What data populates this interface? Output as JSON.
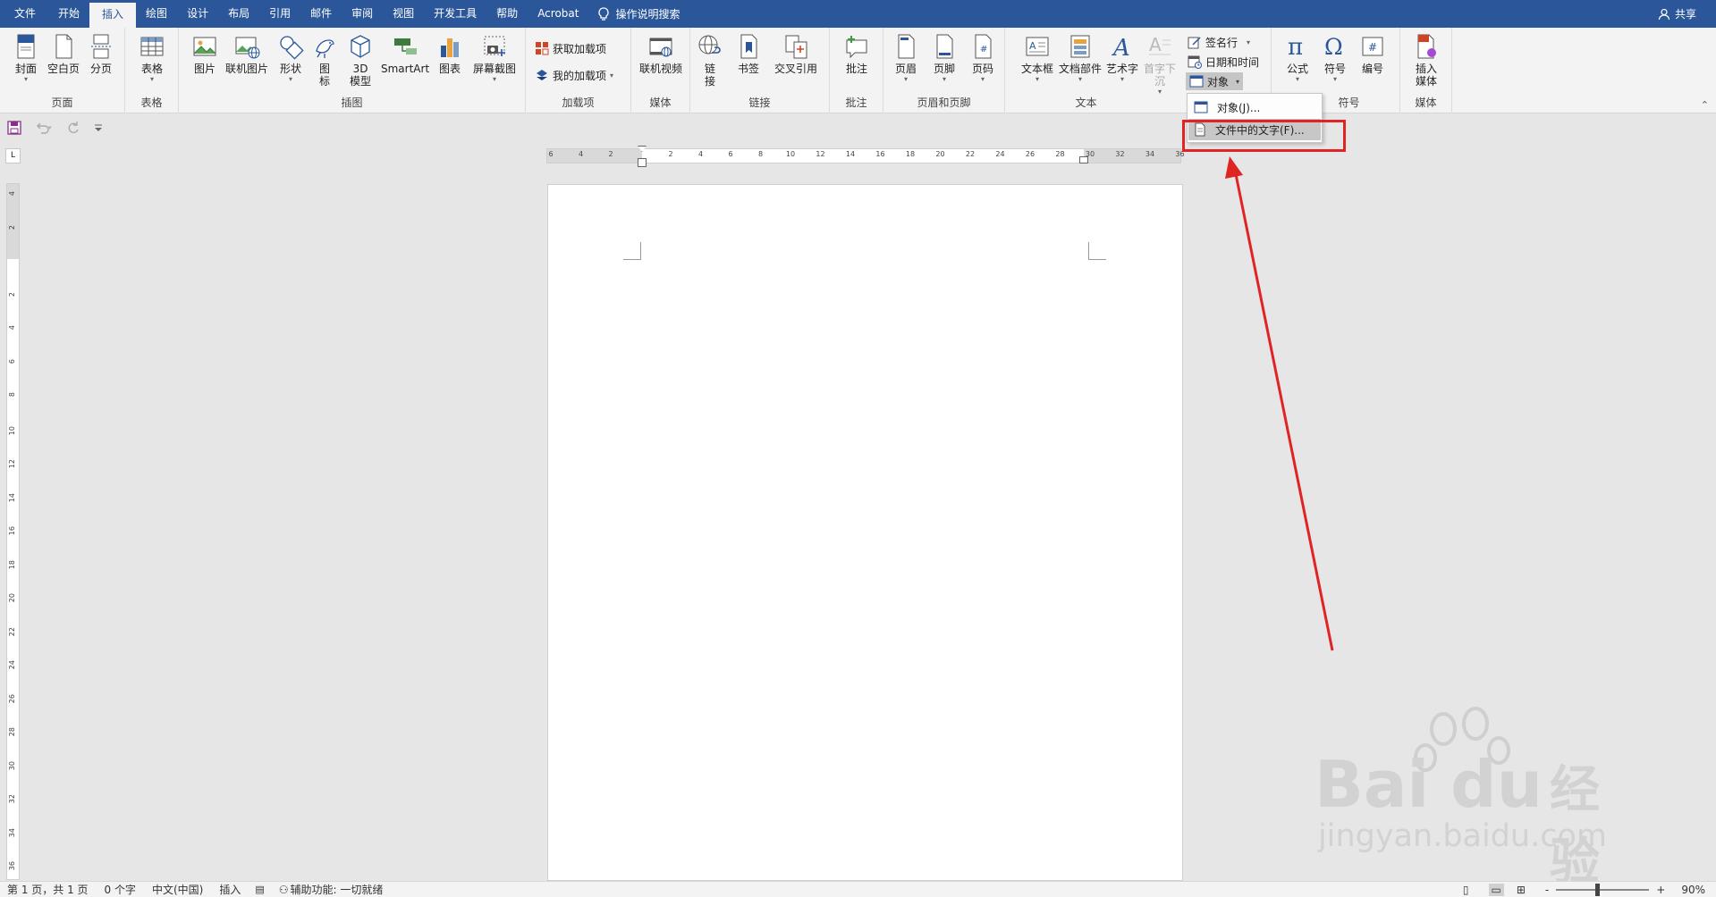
{
  "tabs": [
    "文件",
    "开始",
    "插入",
    "绘图",
    "设计",
    "布局",
    "引用",
    "邮件",
    "审阅",
    "视图",
    "开发工具",
    "帮助",
    "Acrobat"
  ],
  "search_label": "操作说明搜索",
  "share_label": "共享",
  "ribbon": {
    "cover": "封面",
    "blank_page": "空白页",
    "page_break": "分页",
    "group_pages": "页面",
    "table": "表格",
    "group_table": "表格",
    "picture": "图片",
    "online_picture": "联机图片",
    "shapes": "形状",
    "icon_l1": "图",
    "icon_l2": "标",
    "model_l1": "3D",
    "model_l2": "模型",
    "smartart": "SmartArt",
    "chart": "图表",
    "screenshot": "屏幕截图",
    "group_illustrations": "插图",
    "get_addins": "获取加载项",
    "my_addins": "我的加载项",
    "group_addins": "加载项",
    "online_video": "联机视频",
    "group_media1": "媒体",
    "link_l1": "链",
    "link_l2": "接",
    "bookmark": "书签",
    "cross_ref": "交叉引用",
    "group_links": "链接",
    "comment": "批注",
    "group_comments": "批注",
    "header": "页眉",
    "footer": "页脚",
    "page_number": "页码",
    "group_header_footer": "页眉和页脚",
    "textbox": "文本框",
    "quick_parts": "文档部件",
    "wordart": "艺术字",
    "dropcap": "首字下沉",
    "signature_line": "签名行",
    "date_time": "日期和时间",
    "object": "对象",
    "group_text": "文本",
    "equation": "公式",
    "symbol": "符号",
    "number": "编号",
    "group_symbols": "符号",
    "insert_media_l1": "插入",
    "insert_media_l2": "媒体",
    "group_media2": "媒体"
  },
  "menu": {
    "item_object": "对象(J)...",
    "item_text_from_file": "文件中的文字(F)..."
  },
  "hruler_labels": [
    "6",
    "4",
    "2",
    "",
    "2",
    "4",
    "6",
    "8",
    "10",
    "12",
    "14",
    "16",
    "18",
    "20",
    "22",
    "24",
    "26",
    "28",
    "30",
    "32",
    "34",
    "36"
  ],
  "vruler_labels": [
    "4",
    "2",
    "",
    "2",
    "4",
    "6",
    "8",
    "10",
    "12",
    "14",
    "16",
    "18",
    "20",
    "22",
    "24",
    "26",
    "28",
    "30",
    "32",
    "34",
    "36"
  ],
  "status": {
    "page": "第 1 页，共 1 页",
    "words": "0 个字",
    "language": "中文(中国)",
    "mode": "插入",
    "accessibility": "辅助功能: 一切就绪",
    "zoom": "90%",
    "zoom_minus": "-",
    "zoom_plus": "+"
  },
  "watermark": {
    "brand": "Bai",
    "brand2": "du",
    "cn": "经验",
    "url": "jingyan.baidu.com"
  },
  "colors": {
    "tab_bar": "#2b579a",
    "ribbon_bg": "#f3f3f3",
    "annotation_red": "#e02424"
  }
}
